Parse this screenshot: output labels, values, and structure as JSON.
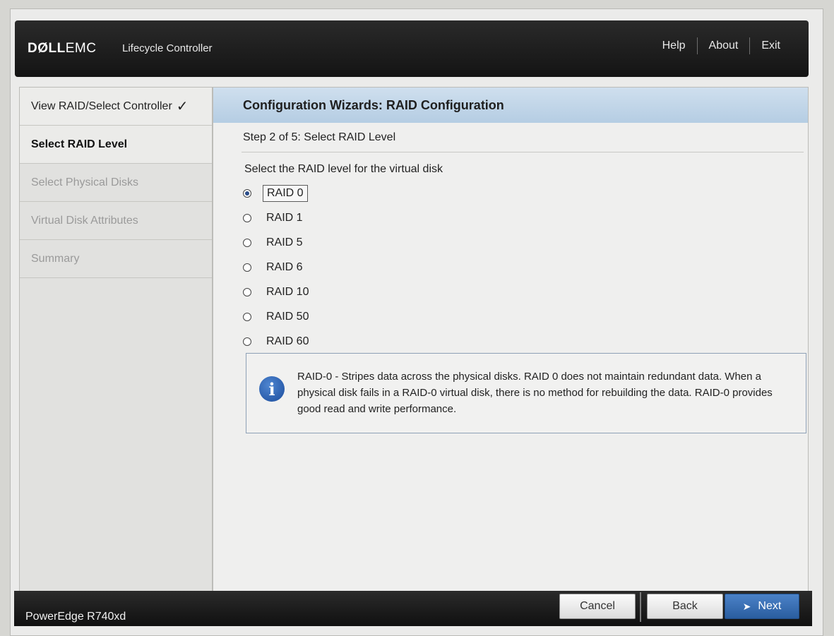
{
  "header": {
    "brand_dell": "DØLL",
    "brand_emc": "EMC",
    "product": "Lifecycle Controller",
    "nav": [
      "Help",
      "About",
      "Exit"
    ]
  },
  "sidebar": {
    "steps": [
      {
        "label": "View RAID/Select Controller",
        "state": "done"
      },
      {
        "label": "Select RAID Level",
        "state": "current"
      },
      {
        "label": "Select Physical Disks",
        "state": "pending"
      },
      {
        "label": "Virtual Disk Attributes",
        "state": "pending"
      },
      {
        "label": "Summary",
        "state": "pending"
      }
    ]
  },
  "main": {
    "title": "Configuration Wizards: RAID Configuration",
    "step_label": "Step 2 of 5: Select RAID Level",
    "prompt": "Select the RAID level for the virtual disk",
    "options": [
      "RAID 0",
      "RAID 1",
      "RAID 5",
      "RAID 6",
      "RAID 10",
      "RAID 50",
      "RAID 60"
    ],
    "selected_option": "RAID 0",
    "info": {
      "icon": "info-icon",
      "icon_glyph": "i",
      "text": "RAID-0 - Stripes data across the physical disks. RAID 0 does not maintain redundant data. When a physical disk fails in a RAID-0 virtual disk, there is no method for rebuilding the data. RAID-0 provides good read and write performance."
    }
  },
  "footer": {
    "model": "PowerEdge R740xd",
    "cancel_label": "Cancel",
    "back_label": "Back",
    "next_label": "Next"
  },
  "colors": {
    "header_bg": "#1c1c1c",
    "title_band": "#c3d7ea",
    "next_button": "#3a70b4",
    "info_icon": "#2a5fae"
  }
}
